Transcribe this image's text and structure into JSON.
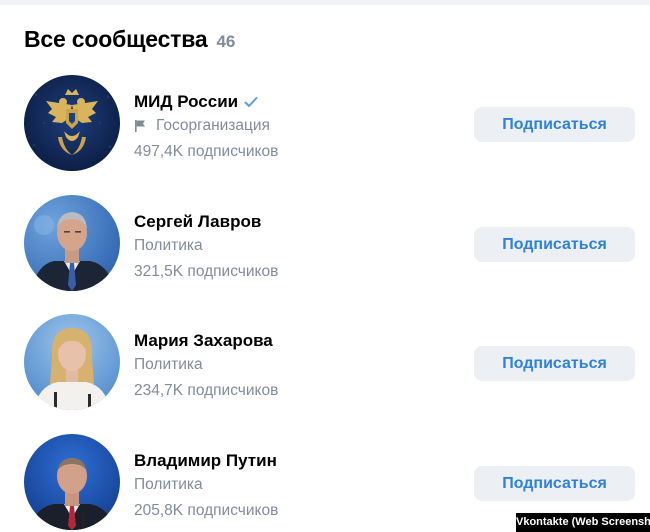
{
  "header": {
    "title": "Все сообщества",
    "count": "46"
  },
  "communities": [
    {
      "name": "МИД России",
      "verified": true,
      "category": "Госорганизация",
      "category_icon": "flag-icon",
      "followers": "497,4K подписчиков",
      "button_label": "Подписаться"
    },
    {
      "name": "Сергей Лавров",
      "verified": false,
      "category": "Политика",
      "followers": "321,5K подписчиков",
      "button_label": "Подписаться"
    },
    {
      "name": "Мария Захарова",
      "verified": false,
      "category": "Политика",
      "followers": "234,7K подписчиков",
      "button_label": "Подписаться"
    },
    {
      "name": "Владимир Путин",
      "verified": false,
      "category": "Политика",
      "followers": "205,8K подписчиков",
      "button_label": "Подписаться"
    }
  ],
  "credit": "Vkontakte (Web Screenshot)",
  "colors": {
    "accent": "#2d81e0",
    "secondary_text": "#818c99",
    "button_bg": "#eceff3"
  }
}
